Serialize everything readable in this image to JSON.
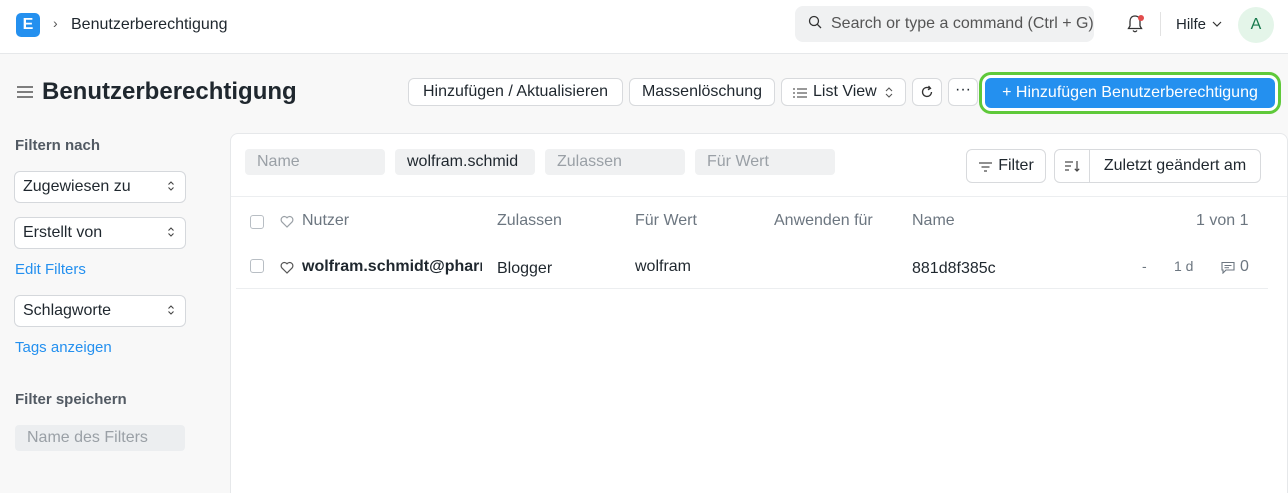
{
  "navbar": {
    "logo_letter": "E",
    "breadcrumb": "Benutzerberechtigung",
    "search_placeholder": "Search or type a command (Ctrl + G)",
    "help_label": "Hilfe",
    "avatar_initial": "A"
  },
  "page": {
    "title": "Benutzerberechtigung",
    "actions": {
      "add_update": "Hinzufügen / Aktualisieren",
      "bulk_delete": "Massenlöschung",
      "view": "List View",
      "more": "···",
      "primary": "+ Hinzufügen Benutzerberechtigung"
    }
  },
  "sidebar": {
    "filter_by": "Filtern nach",
    "assigned_to": "Zugewiesen zu",
    "created_by": "Erstellt von",
    "edit_filters": "Edit Filters",
    "tags": "Schlagworte",
    "show_tags": "Tags anzeigen",
    "save_filter": "Filter speichern",
    "filter_name_placeholder": "Name des Filters"
  },
  "list": {
    "filters": {
      "name_placeholder": "Name",
      "user_value": "wolfram.schmid",
      "allow_placeholder": "Zulassen",
      "for_value_placeholder": "Für Wert"
    },
    "filter_button": "Filter",
    "sort_label": "Zuletzt geändert am",
    "columns": {
      "user": "Nutzer",
      "allow": "Zulassen",
      "for_value": "Für Wert",
      "apply_to": "Anwenden für",
      "name": "Name",
      "count": "1 von 1"
    },
    "rows": [
      {
        "user": "wolfram.schmidt@pharma",
        "allow": "Blogger",
        "for_value": "wolfram",
        "name": "881d8f385c",
        "dash": "-",
        "modified": "1 d",
        "comments": "0"
      }
    ]
  },
  "colors": {
    "primary": "#2490ef",
    "highlight": "#5fc93a"
  }
}
